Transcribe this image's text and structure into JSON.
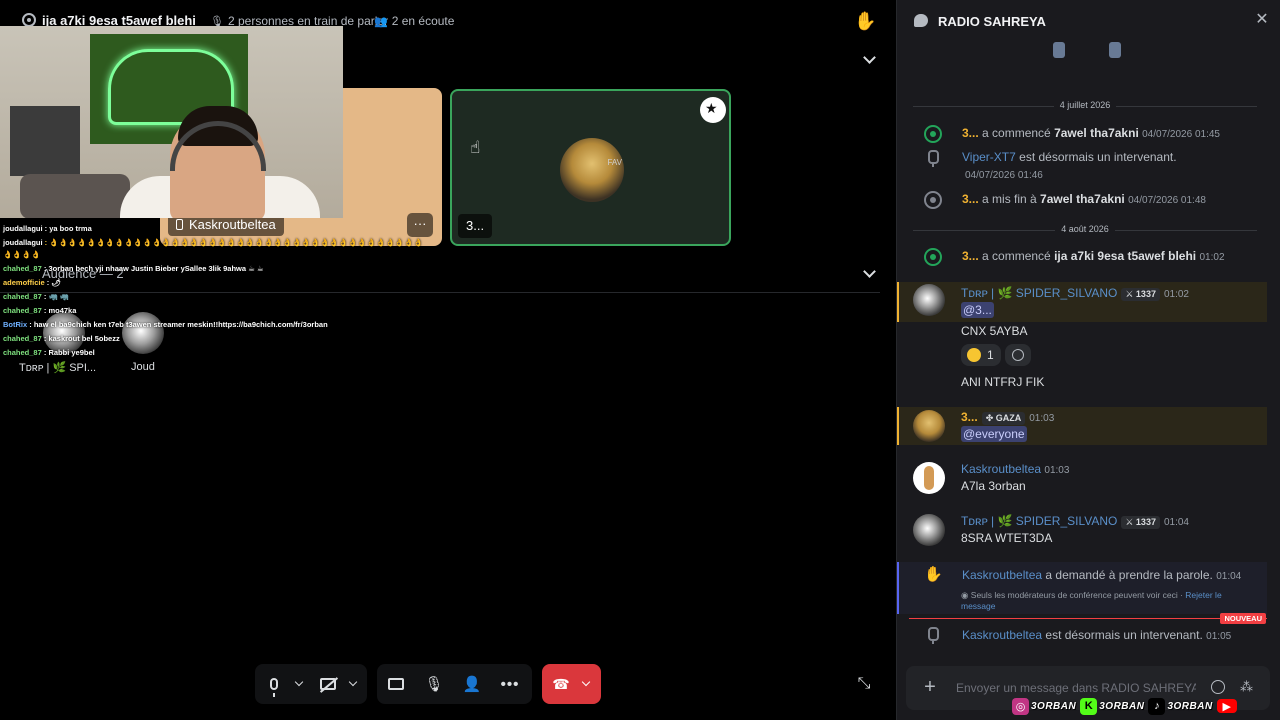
{
  "stage": {
    "title": "ija a7ki 9esa t5awef blehi",
    "speakers_info": "2 personnes en train de parler",
    "listeners_info": "2 en écoute",
    "audience_title": "Audience — 2",
    "tiles": [
      {
        "name": "Kaskroutbeltea",
        "more": "···"
      },
      {
        "name": "3..."
      }
    ],
    "audience": [
      {
        "name": "Tᴅʀᴘ | 🌿 SPI..."
      },
      {
        "name": "Joud"
      }
    ]
  },
  "overlay_chat": [
    {
      "user": "joudallagui",
      "color": "white",
      "text": " : ya boo trma"
    },
    {
      "user": "joudallagui",
      "color": "white",
      "text": " : 👌👌👌👌👌👌👌👌👌👌👌👌👌👌👌👌👌👌👌👌👌👌👌👌👌👌👌👌👌👌👌👌👌👌👌👌👌👌👌👌"
    },
    {
      "user": "",
      "color": "white",
      "text": "👌👌👌👌"
    },
    {
      "user": "chahed_87",
      "color": "green",
      "text": " : 3orban bech yji nhaaw Justin Bieber ySallee 3lik 9ahwa ☕ ☕"
    },
    {
      "user": "ademofficie",
      "color": "yellow",
      "text": " : 🌶"
    },
    {
      "user": "chahed_87",
      "color": "green",
      "text": " : 🦏 🦏"
    },
    {
      "user": "chahed_87",
      "color": "green",
      "text": " : mo47ka"
    },
    {
      "user": "BotRix",
      "color": "blue",
      "text": " : haw el ba9chich ken t7eb t3awen streamer meskin!!https://ba9chich.com/fr/3orban"
    },
    {
      "user": "chahed_87",
      "color": "green",
      "text": " : kaskrout bel 5obezz"
    },
    {
      "user": "chahed_87",
      "color": "green",
      "text": " : Rabbi ye9bel"
    }
  ],
  "chat": {
    "title": "RADIO SAHREYA",
    "placeholder": "Envoyer un message dans RADIO SAHREYA",
    "days": [
      "4 juillet 2026",
      "4 août 2026"
    ],
    "system": [
      {
        "user": "3...",
        "action": " a commencé ",
        "target": "7awel tha7akni",
        "time": "04/07/2026 01:45"
      },
      {
        "user": "Viper-XT7",
        "action": " est désormais un intervenant.",
        "time": "04/07/2026 01:46"
      },
      {
        "user": "3...",
        "action": " a mis fin à ",
        "target": "7awel tha7akni",
        "time": "04/07/2026 01:48"
      },
      {
        "user": "3...",
        "action": " a commencé ",
        "target": "ija a7ki 9esa t5awef blehi",
        "time": "01:02"
      },
      {
        "user": "Kaskroutbeltea",
        "action": " a demandé à prendre la parole.",
        "time": "01:04"
      },
      {
        "user": "Kaskroutbeltea",
        "action": " est désormais un intervenant.",
        "time": "01:05"
      }
    ],
    "messages": [
      {
        "author_prefix": "Tᴅʀᴘ | 🌿",
        "author": "SPIDER_SILVANO",
        "tag": "⚔ 1337",
        "time": "01:02",
        "mention": "@3...",
        "lines": [
          "CNX 5AYBA",
          "ANI NTFRJ FIK"
        ],
        "reaction_count": "1"
      },
      {
        "author": "3...",
        "tag": "✤ GAZA",
        "time": "01:03",
        "mention": "@everyone"
      },
      {
        "author": "Kaskroutbeltea",
        "time": "01:03",
        "lines": [
          "A7la 3orban"
        ]
      },
      {
        "author_prefix": "Tᴅʀᴘ | 🌿",
        "author": "SPIDER_SILVANO",
        "tag": "⚔ 1337",
        "time": "01:04",
        "lines": [
          "8SRA WTET3DA"
        ]
      }
    ],
    "mod_note": "Seuls les modérateurs de conférence peuvent voir ceci · ",
    "mod_note_link": "Rejeter le message",
    "new_badge": "NOUVEAU"
  },
  "branding": [
    {
      "icon": "instagram-icon",
      "text": "3ORBAN",
      "color": "#c13584"
    },
    {
      "icon": "kick-icon",
      "text": "3ORBAN",
      "color": "#53fc18"
    },
    {
      "icon": "tiktok-icon",
      "text": "3ORBAN",
      "color": "#000000"
    },
    {
      "icon": "youtube-icon",
      "color": "#ff0000"
    }
  ],
  "colors": {
    "accent_green": "#23a55a",
    "leave_red": "#da373c",
    "highlight_yellow": "#f0b232",
    "new_red": "#f23f43"
  }
}
